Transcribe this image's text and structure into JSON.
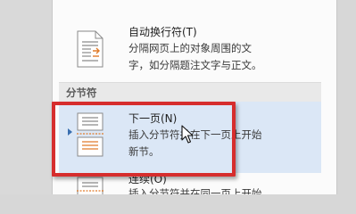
{
  "menu": {
    "top_item": {
      "title": "自动换行符(T)",
      "desc_line1": "分隔网页上的对象周围的文",
      "desc_line2": "字，如分隔题注文字与正文。",
      "icon": "text-wrapping-break-icon"
    },
    "section_header": "分节符",
    "selected_item": {
      "title": "下一页(N)",
      "desc_line1": "插入分节符并在下一页上开始",
      "desc_line2": "新节。",
      "icon": "next-page-section-break-icon"
    },
    "bottom_item": {
      "title": "连续(O)",
      "desc_line1": "插入分节符并在同一页上开始",
      "icon": "continuous-section-break-icon"
    }
  },
  "colors": {
    "highlight_border": "#d62d2d",
    "selected_background": "#dbe7f6",
    "icon_accent": "#e07b2a"
  }
}
